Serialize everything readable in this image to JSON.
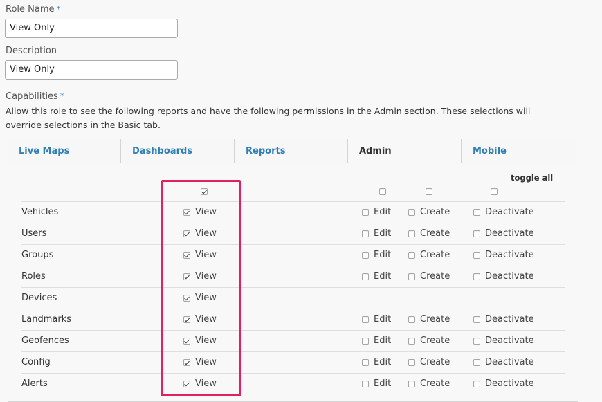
{
  "role_name": {
    "label": "Role Name",
    "required_mark": "*",
    "value": "View Only"
  },
  "description": {
    "label": "Description",
    "value": "View Only"
  },
  "capabilities": {
    "label": "Capabilities",
    "required_mark": "*",
    "help_text": "Allow this role to see the following reports and have the following permissions in the Admin section. These selections will override selections in the Basic tab."
  },
  "tabs": [
    {
      "label": "Live Maps",
      "active": false
    },
    {
      "label": "Dashboards",
      "active": false
    },
    {
      "label": "Reports",
      "active": false
    },
    {
      "label": "Admin",
      "active": true
    },
    {
      "label": "Mobile",
      "active": false
    }
  ],
  "toggle_all_label": "toggle all",
  "header_checks": {
    "view": true,
    "edit": false,
    "create": false,
    "deactivate": false
  },
  "permission_labels": {
    "view": "View",
    "edit": "Edit",
    "create": "Create",
    "deactivate": "Deactivate"
  },
  "rows": [
    {
      "name": "Vehicles",
      "view": true,
      "has_edit": true,
      "edit": false,
      "create": false,
      "deactivate": false
    },
    {
      "name": "Users",
      "view": true,
      "has_edit": true,
      "edit": false,
      "create": false,
      "deactivate": false
    },
    {
      "name": "Groups",
      "view": true,
      "has_edit": true,
      "edit": false,
      "create": false,
      "deactivate": false
    },
    {
      "name": "Roles",
      "view": true,
      "has_edit": true,
      "edit": false,
      "create": false,
      "deactivate": false
    },
    {
      "name": "Devices",
      "view": true,
      "has_edit": false
    },
    {
      "name": "Landmarks",
      "view": true,
      "has_edit": true,
      "edit": false,
      "create": false,
      "deactivate": false
    },
    {
      "name": "Geofences",
      "view": true,
      "has_edit": true,
      "edit": false,
      "create": false,
      "deactivate": false
    },
    {
      "name": "Config",
      "view": true,
      "has_edit": true,
      "edit": false,
      "create": false,
      "deactivate": false
    },
    {
      "name": "Alerts",
      "view": true,
      "has_edit": true,
      "edit": false,
      "create": false,
      "deactivate": false
    }
  ],
  "colors": {
    "tab_link": "#2f7fb5",
    "required": "#3a8bc8",
    "highlight": "#e0205f"
  }
}
